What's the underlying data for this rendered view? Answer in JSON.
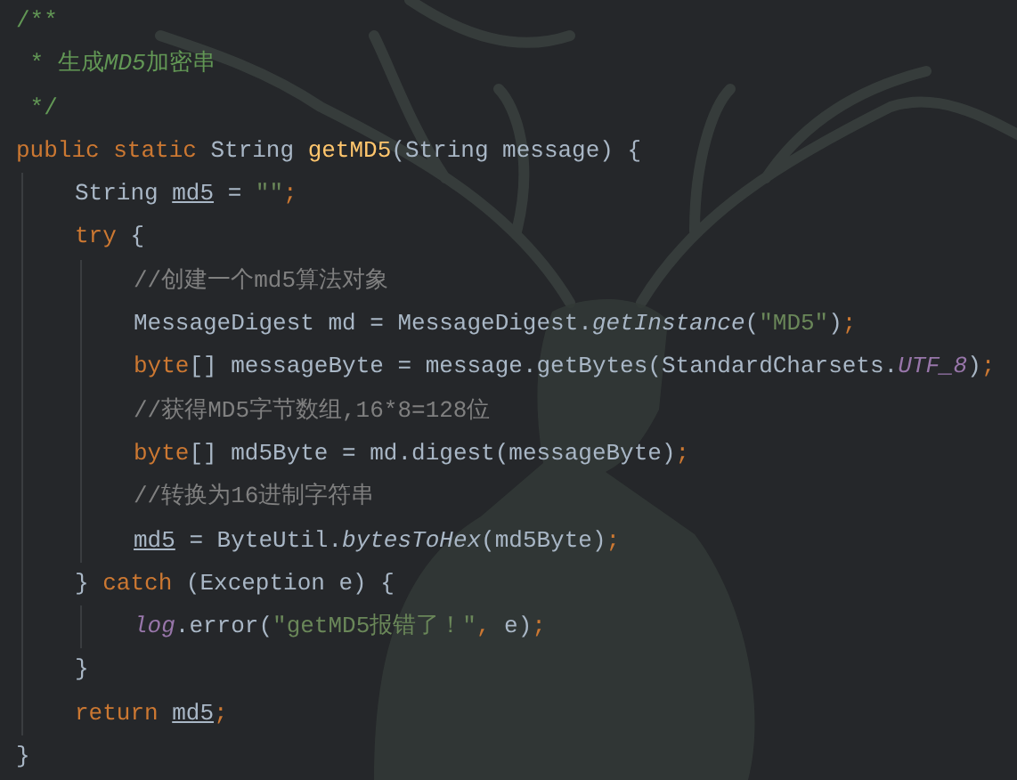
{
  "editor": {
    "lines": [
      {
        "tokens": [
          {
            "text": "/**",
            "kind": "doc"
          }
        ]
      },
      {
        "tokens": [
          {
            "text": " * 生成",
            "kind": "doc"
          },
          {
            "text": "MD5",
            "kind": "doc-italic"
          },
          {
            "text": "加密串",
            "kind": "doc"
          }
        ]
      },
      {
        "tokens": [
          {
            "text": " */",
            "kind": "doc"
          }
        ]
      },
      {
        "tokens": [
          {
            "text": "public static ",
            "kind": "keyword"
          },
          {
            "text": "String ",
            "kind": "plain"
          },
          {
            "text": "getMD5",
            "kind": "decl"
          },
          {
            "text": "(String message) {",
            "kind": "plain"
          }
        ],
        "children": [
          {
            "tokens": [
              {
                "text": "String ",
                "kind": "plain"
              },
              {
                "text": "md5",
                "kind": "var"
              },
              {
                "text": " = ",
                "kind": "plain"
              },
              {
                "text": "\"\"",
                "kind": "string"
              },
              {
                "text": ";",
                "kind": "keyword"
              }
            ]
          },
          {
            "tokens": [
              {
                "text": "try ",
                "kind": "keyword"
              },
              {
                "text": "{",
                "kind": "plain"
              }
            ],
            "children": [
              {
                "tokens": [
                  {
                    "text": "//创建一个md5算法对象",
                    "kind": "comment"
                  }
                ]
              },
              {
                "tokens": [
                  {
                    "text": "MessageDigest md = MessageDigest.",
                    "kind": "plain"
                  },
                  {
                    "text": "getInstance",
                    "kind": "static-call"
                  },
                  {
                    "text": "(",
                    "kind": "plain"
                  },
                  {
                    "text": "\"MD5\"",
                    "kind": "string"
                  },
                  {
                    "text": ")",
                    "kind": "plain"
                  },
                  {
                    "text": ";",
                    "kind": "keyword"
                  }
                ]
              },
              {
                "tokens": [
                  {
                    "text": "byte",
                    "kind": "keyword"
                  },
                  {
                    "text": "[] messageByte = message.getBytes(StandardCharsets.",
                    "kind": "plain"
                  },
                  {
                    "text": "UTF_8",
                    "kind": "field"
                  },
                  {
                    "text": ")",
                    "kind": "plain"
                  },
                  {
                    "text": ";",
                    "kind": "keyword"
                  }
                ]
              },
              {
                "tokens": [
                  {
                    "text": "//获得MD5字节数组,16*8=128位",
                    "kind": "comment"
                  }
                ]
              },
              {
                "tokens": [
                  {
                    "text": "byte",
                    "kind": "keyword"
                  },
                  {
                    "text": "[] md5Byte = md.digest(messageByte)",
                    "kind": "plain"
                  },
                  {
                    "text": ";",
                    "kind": "keyword"
                  }
                ]
              },
              {
                "tokens": [
                  {
                    "text": "//转换为16进制字符串",
                    "kind": "comment"
                  }
                ]
              },
              {
                "tokens": [
                  {
                    "text": "md5",
                    "kind": "var"
                  },
                  {
                    "text": " = ByteUtil.",
                    "kind": "plain"
                  },
                  {
                    "text": "bytesToHex",
                    "kind": "static-call"
                  },
                  {
                    "text": "(md5Byte)",
                    "kind": "plain"
                  },
                  {
                    "text": ";",
                    "kind": "keyword"
                  }
                ]
              }
            ]
          },
          {
            "tokens": [
              {
                "text": "} ",
                "kind": "plain"
              },
              {
                "text": "catch ",
                "kind": "keyword"
              },
              {
                "text": "(Exception e) {",
                "kind": "plain"
              }
            ],
            "children": [
              {
                "tokens": [
                  {
                    "text": "log",
                    "kind": "field"
                  },
                  {
                    "text": ".error(",
                    "kind": "plain"
                  },
                  {
                    "text": "\"getMD5报错了！\"",
                    "kind": "string"
                  },
                  {
                    "text": ", ",
                    "kind": "keyword"
                  },
                  {
                    "text": "e)",
                    "kind": "plain"
                  },
                  {
                    "text": ";",
                    "kind": "keyword"
                  }
                ]
              }
            ]
          },
          {
            "tokens": [
              {
                "text": "}",
                "kind": "plain"
              }
            ]
          },
          {
            "tokens": [
              {
                "text": "return ",
                "kind": "keyword"
              },
              {
                "text": "md5",
                "kind": "var"
              },
              {
                "text": ";",
                "kind": "keyword"
              }
            ]
          }
        ]
      },
      {
        "tokens": [
          {
            "text": "}",
            "kind": "plain"
          }
        ]
      }
    ]
  }
}
